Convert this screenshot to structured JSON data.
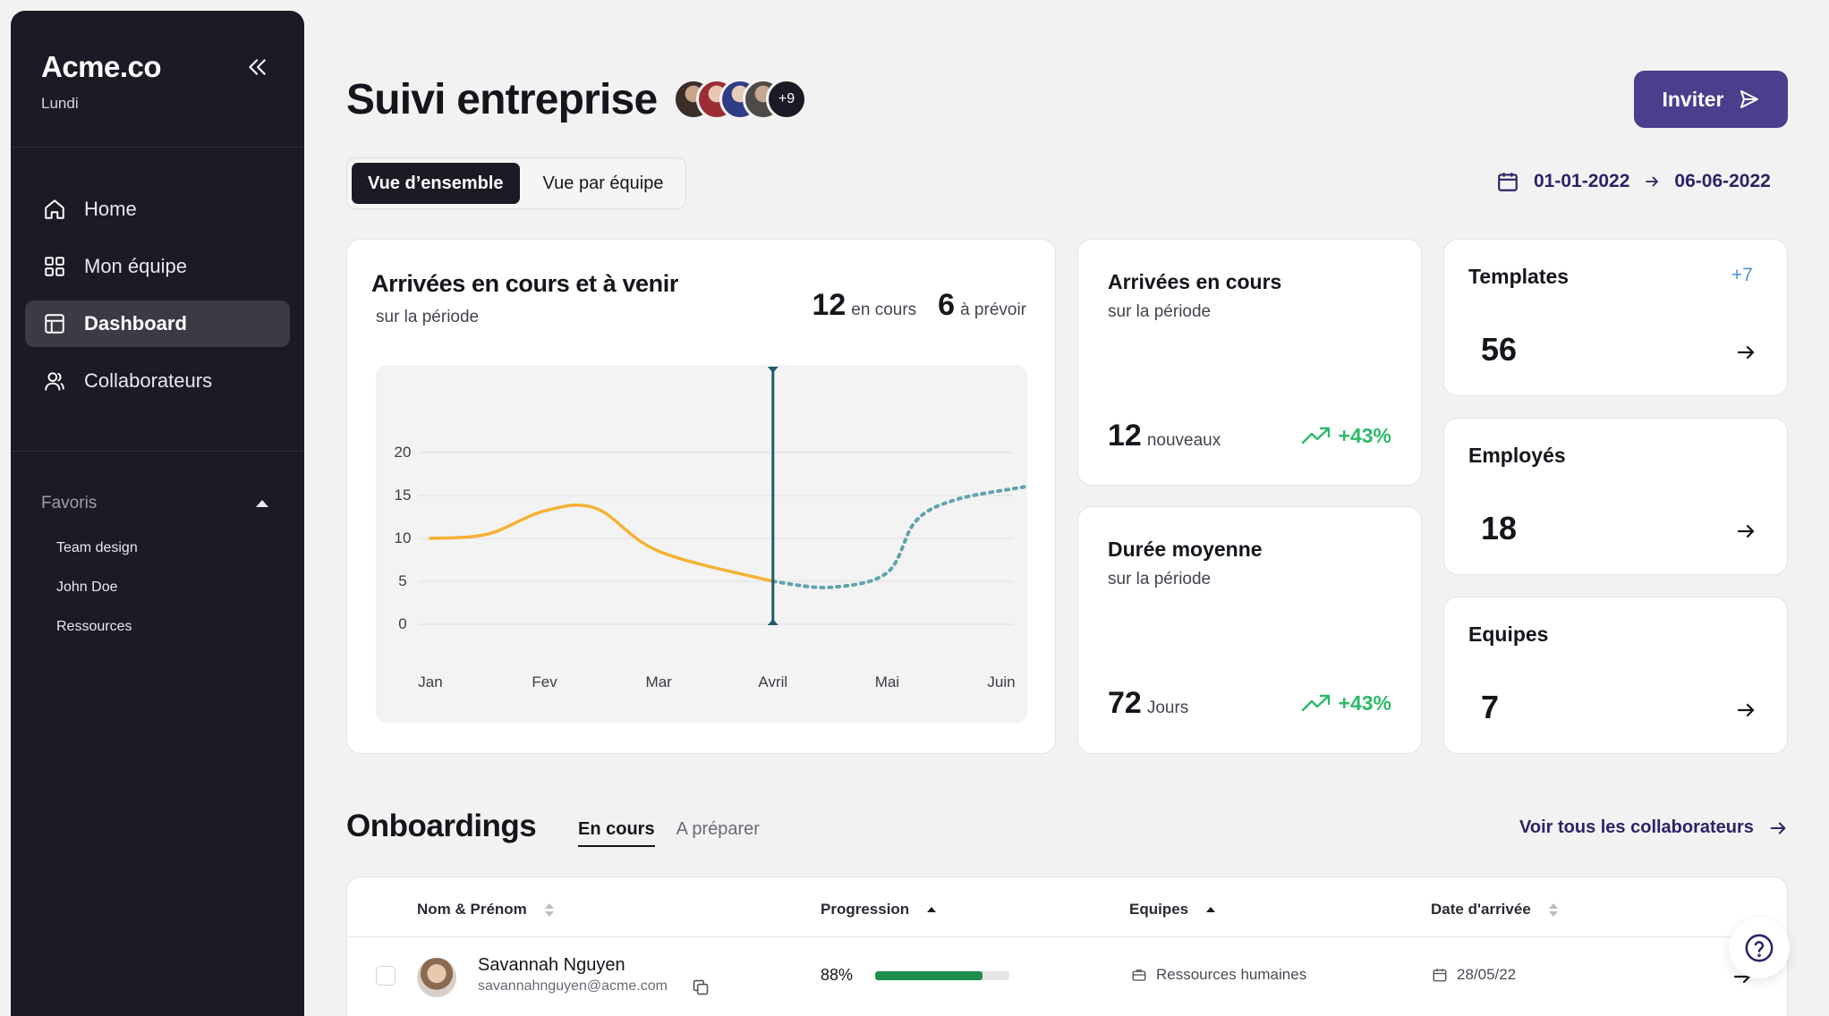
{
  "app": {
    "name": "Acme.co",
    "subtitle": "Lundi"
  },
  "sidebar": {
    "nav": [
      {
        "label": "Home",
        "icon": "home-icon"
      },
      {
        "label": "Mon équipe",
        "icon": "grid-icon"
      },
      {
        "label": "Dashboard",
        "icon": "dashboard-icon",
        "active": true
      },
      {
        "label": "Collaborateurs",
        "icon": "users-icon"
      }
    ],
    "favorites_label": "Favoris",
    "favorites": [
      "Team design",
      "John Doe",
      "Ressources"
    ]
  },
  "header": {
    "title": "Suivi entreprise",
    "avatars_more": "+9",
    "invite_label": "Inviter",
    "tabs": [
      "Vue d’ensemble",
      "Vue par équipe"
    ],
    "date_start": "01-01-2022",
    "date_end": "06-06-2022"
  },
  "chart_card": {
    "title": "Arrivées en cours et à venir",
    "subtitle": "sur la période",
    "current_value": "12",
    "current_label": "en cours",
    "planned_value": "6",
    "planned_label": "à prévoir"
  },
  "chart_data": {
    "type": "line",
    "title": "Arrivées en cours et à venir",
    "categories": [
      "Jan",
      "Fev",
      "Mar",
      "Avril",
      "Mai",
      "Juin"
    ],
    "yticks": [
      "0",
      "5",
      "10",
      "15",
      "20"
    ],
    "ylim": [
      0,
      25
    ],
    "grid": true,
    "series": [
      {
        "style": "solid",
        "color": "#f5b133",
        "x": [
          0,
          0.5,
          1.0,
          1.45,
          2.0,
          3.0
        ],
        "values": [
          10,
          10.5,
          13.2,
          13.5,
          8.5,
          5
        ]
      },
      {
        "style": "dotted",
        "color": "#5fa4ad",
        "x": [
          3.0,
          3.5,
          4.0,
          4.25,
          4.6,
          5.2
        ],
        "values": [
          5,
          4.3,
          6,
          12,
          14.5,
          16
        ]
      }
    ],
    "marker_x": "Avril",
    "marker_color": "#1f5c68"
  },
  "stats": [
    {
      "title": "Arrivées en cours",
      "subtitle": "sur la période",
      "value": "12",
      "unit": "nouveaux",
      "trend": "+43%"
    },
    {
      "title": "Durée moyenne",
      "subtitle": "sur la période",
      "value": "72",
      "unit": "Jours",
      "trend": "+43%"
    }
  ],
  "kpis": [
    {
      "title": "Templates",
      "extra": "+7",
      "value": "56"
    },
    {
      "title": "Employés",
      "extra": "",
      "value": "18"
    },
    {
      "title": "Equipes",
      "extra": "",
      "value": "7"
    }
  ],
  "onboardings": {
    "title": "Onboardings",
    "tabs": [
      "En cours",
      "A préparer"
    ],
    "link": "Voir tous les collaborateurs",
    "columns": [
      "Nom & Prénom",
      "Progression",
      "Equipes",
      "Date d'arrivée"
    ],
    "rows": [
      {
        "name": "Savannah Nguyen",
        "email": "savannahnguyen@acme.co​m",
        "progress_label": "88%",
        "progress": 0.8,
        "team": "Ressources humaines",
        "date": "28/05/22"
      }
    ]
  },
  "colors": {
    "sidebar": "#1b1a25",
    "accent": "#4a3f8c",
    "positive": "#2dba6a",
    "progress": "#1e8e4d"
  }
}
